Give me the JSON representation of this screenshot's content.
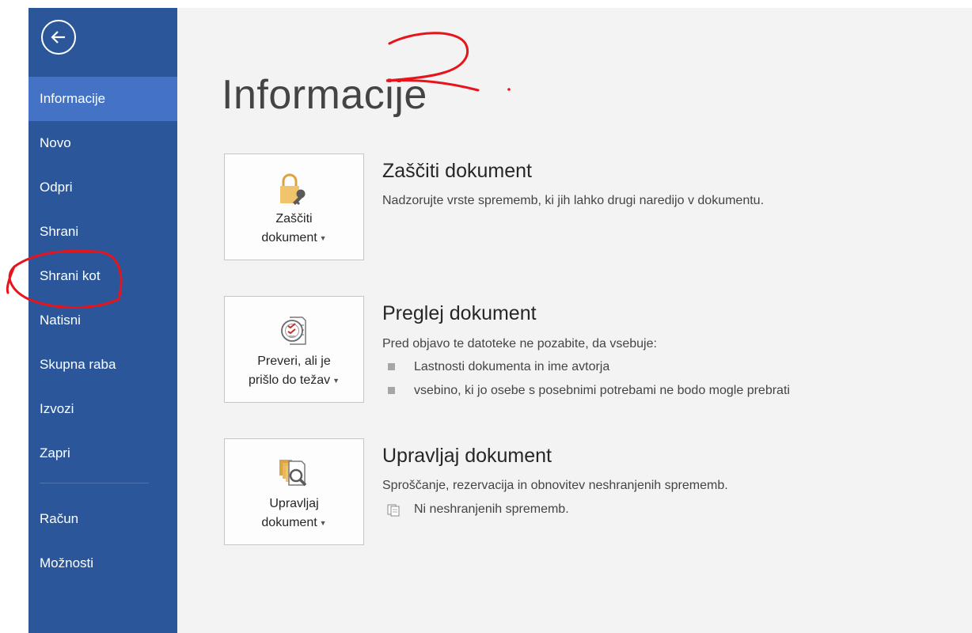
{
  "sidebar": {
    "back_label": "Back",
    "items": [
      {
        "label": "Informacije"
      },
      {
        "label": "Novo"
      },
      {
        "label": "Odpri"
      },
      {
        "label": "Shrani"
      },
      {
        "label": "Shrani kot"
      },
      {
        "label": "Natisni"
      },
      {
        "label": "Skupna raba"
      },
      {
        "label": "Izvozi"
      },
      {
        "label": "Zapri"
      },
      {
        "label": "Račun"
      },
      {
        "label": "Možnosti"
      }
    ],
    "active": "Informacije"
  },
  "main": {
    "title": "Informacije",
    "sections": [
      {
        "button_line1": "Zaščiti",
        "button_line2": "dokument",
        "icon": "lock-key-icon",
        "heading": "Zaščiti dokument",
        "description": "Nadzorujte vrste sprememb, ki jih lahko drugi naredijo v dokumentu."
      },
      {
        "button_line1": "Preveri, ali je",
        "button_line2": "prišlo do težav",
        "icon": "inspect-document-icon",
        "heading": "Preglej dokument",
        "description": "Pred objavo te datoteke ne pozabite, da vsebuje:",
        "bullets": [
          "Lastnosti dokumenta in ime avtorja",
          "vsebino, ki jo osebe s posebnimi potrebami ne bodo mogle prebrati"
        ]
      },
      {
        "button_line1": "Upravljaj",
        "button_line2": "dokument",
        "icon": "manage-document-icon",
        "heading": "Upravljaj dokument",
        "description": "Sproščanje, rezervacija in obnovitev neshranjenih sprememb.",
        "note": "Ni neshranjenih sprememb.",
        "note_icon": "document-small-icon"
      }
    ]
  },
  "annotations": {
    "handwritten_number": "2",
    "color": "#e8141b"
  },
  "colors": {
    "sidebar": "#2b579a",
    "sidebar_active": "#4472c4",
    "content_bg": "#f3f3f3"
  }
}
